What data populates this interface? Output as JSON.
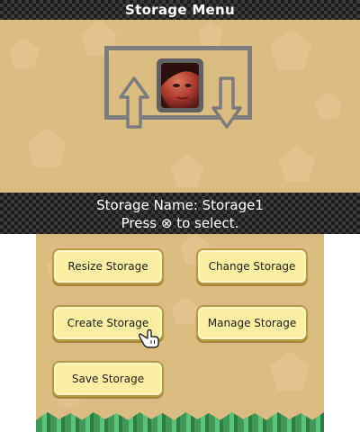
{
  "top_screen": {
    "title": "Storage Menu"
  },
  "info_bar": {
    "storage_name": "Storage Name: Storage1",
    "instruction": "Press ⊗ to select."
  },
  "menu": {
    "resize_label": "Resize Storage",
    "change_label": "Change Storage",
    "create_label": "Create Storage",
    "manage_label": "Manage Storage",
    "save_label": "Save Storage"
  },
  "icons": [
    "up-arrow-icon",
    "down-arrow-icon",
    "hand-cursor-icon"
  ],
  "colors": {
    "background": "#dabc82",
    "button_fill": "#fbeea2",
    "frame_gray": "#7d7d7d",
    "bar": "#1c1c1c"
  }
}
